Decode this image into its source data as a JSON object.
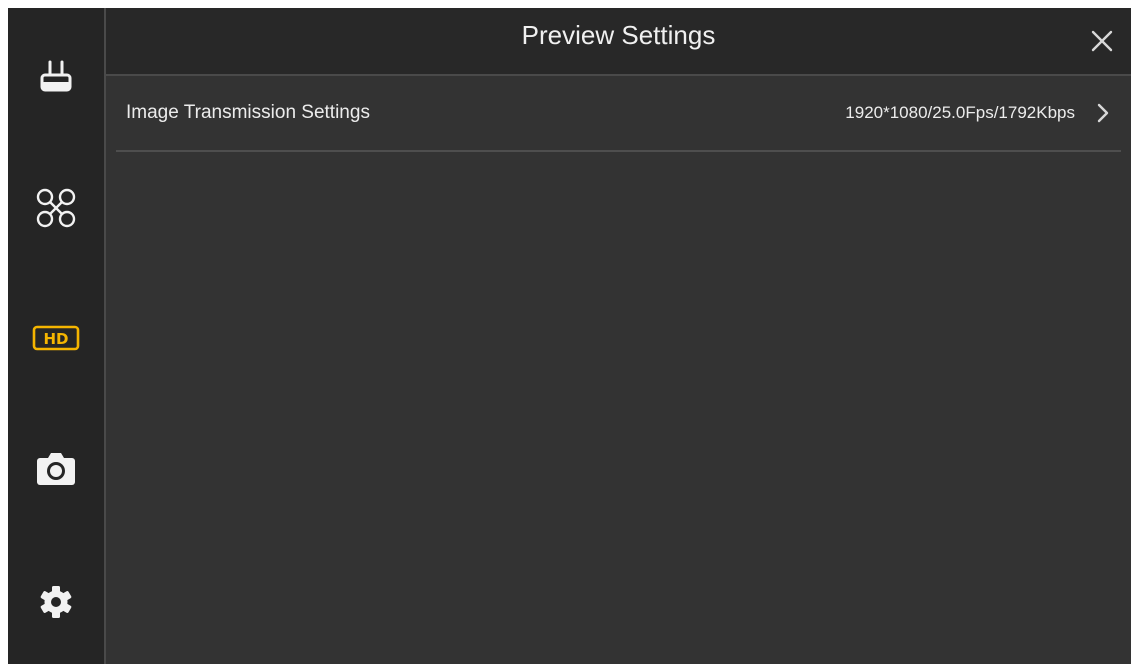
{
  "header": {
    "title": "Preview Settings",
    "close_icon": "close-icon"
  },
  "sidebar": {
    "items": [
      {
        "icon": "remote-controller-icon",
        "active": false
      },
      {
        "icon": "drone-icon",
        "active": false
      },
      {
        "icon": "hd-icon",
        "active": true
      },
      {
        "icon": "camera-icon",
        "active": false
      },
      {
        "icon": "gear-icon",
        "active": false
      }
    ]
  },
  "settings": {
    "image_transmission": {
      "label": "Image Transmission Settings",
      "value": "1920*1080/25.0Fps/1792Kbps",
      "icon": "chevron-right-icon"
    }
  },
  "colors": {
    "accent": "#f5b500",
    "icon": "#f2f2f2",
    "text": "#ececec",
    "background": "#333333",
    "sidebar": "#252525"
  }
}
